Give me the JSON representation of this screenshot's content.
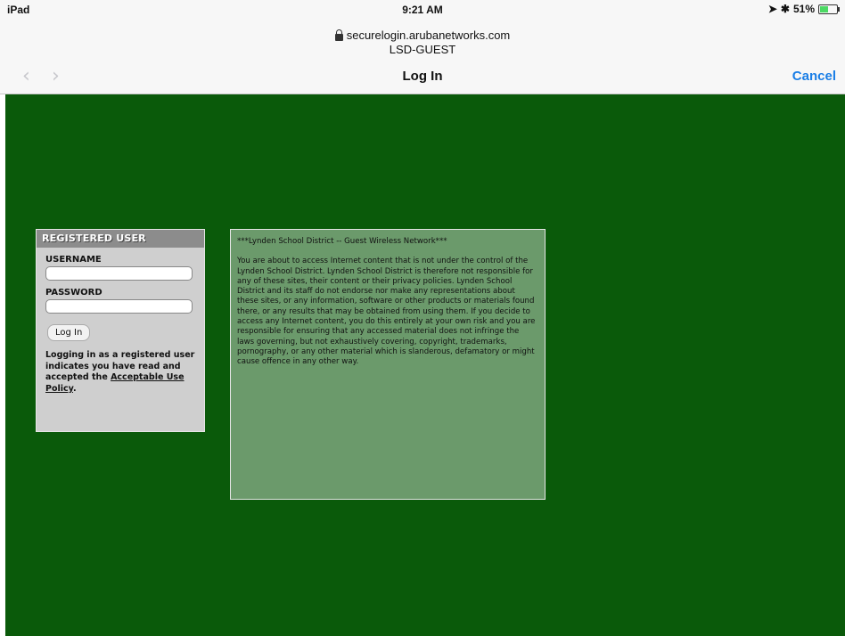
{
  "status_bar": {
    "device": "iPad",
    "time": "9:21 AM",
    "battery_text": "51%",
    "battery_level": 0.51
  },
  "address_bar": {
    "domain": "securelogin.arubanetworks.com",
    "ssid": "LSD-GUEST"
  },
  "nav_bar": {
    "back_icon": "chevron-left-icon",
    "forward_icon": "chevron-right-icon",
    "title": "Log In",
    "cancel_label": "Cancel"
  },
  "login": {
    "header": "REGISTERED USER",
    "username_label": "USERNAME",
    "username_value": "",
    "password_label": "PASSWORD",
    "password_value": "",
    "button_label": "Log In",
    "note_text": "Logging in as a registered user indicates you have read and accepted the",
    "policy_link": "Acceptable Use Policy",
    "note_end": "."
  },
  "notice": {
    "title": "***Lynden School District -- Guest Wireless Network***",
    "body": "You are about to access Internet content that is not under the control of the Lynden School District. Lynden School District is therefore not responsible for any of these sites, their content or their privacy policies. Lynden School District and its staff do not endorse nor make any representations about these sites, or any information, software or other products or materials found there, or any results that may be obtained from using them. If you decide to access any Internet content, you do this entirely at your own risk and you are responsible for ensuring that any accessed material does not infringe the laws governing, but not exhaustively covering, copyright, trademarks, pornography, or any other material which is slanderous, defamatory or might cause offence in any other way."
  },
  "colors": {
    "page_background": "#0a5a0a",
    "notice_background": "#6b9a6b",
    "link_blue": "#1a7ee6"
  }
}
